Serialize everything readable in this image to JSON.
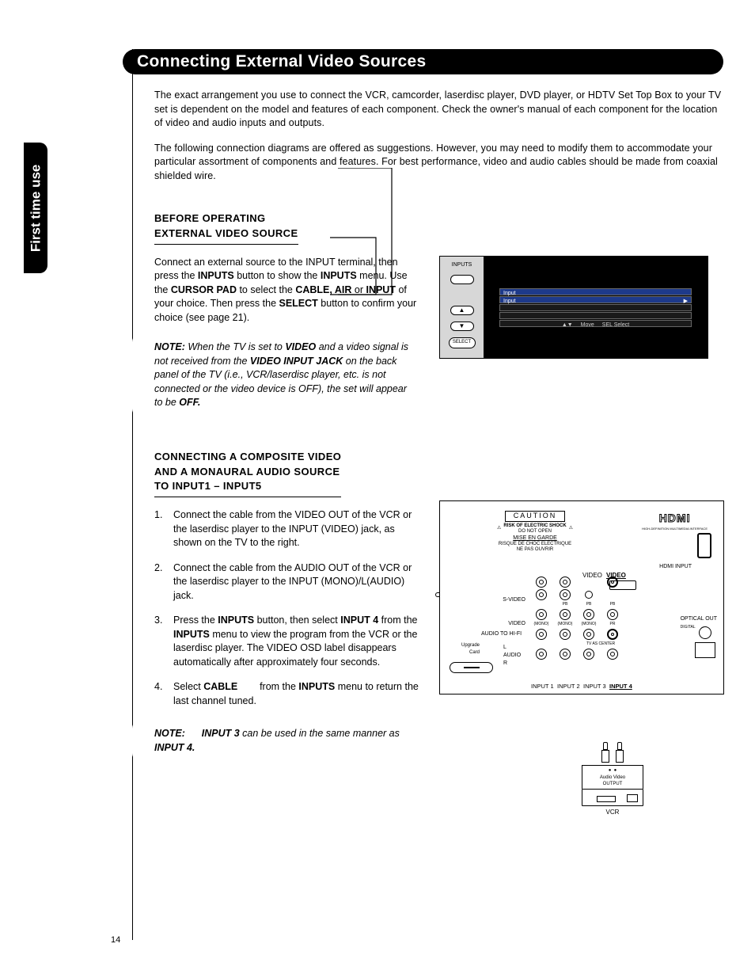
{
  "sideTab": "First time use",
  "title": "Connecting External Video Sources",
  "intro": {
    "p1": "The exact arrangement you use to connect the VCR, camcorder, laserdisc player, DVD player, or HDTV Set Top Box to your TV set is dependent on the model and features of each component. Check the owner's manual of each component for the location of video and audio inputs and outputs.",
    "p2": "The following connection diagrams are offered as suggestions. However, you may need to modify them to accommodate your particular assortment of components and features. For best performance, video and audio cables should be made from coaxial shielded wire."
  },
  "section1": {
    "heading_l1": "BEFORE OPERATING",
    "heading_l2": "EXTERNAL VIDEO SOURCE",
    "p1a": "Connect an external source to the INPUT terminal, then press the ",
    "p1b": "INPUTS",
    "p1c": " button to show the ",
    "p1d": "INPUTS",
    "p1e": " menu. Use the ",
    "p1f": "CURSOR PAD",
    "p1g": " to select the ",
    "p1h": "CABLE, AIR",
    "p1i": " or ",
    "p1j": "INPUT",
    "p1k": " of your choice. Then press the ",
    "p1l": "SELECT",
    "p1m": " button to confirm your choice (see page 21).",
    "note_label": "NOTE:",
    "note_a": "When the TV is set to ",
    "note_b": "VIDEO",
    "note_c": " and a video signal is not received from the ",
    "note_d": "VIDEO INPUT JACK",
    "note_e": " on the back panel of the TV (i.e., VCR/laserdisc player, etc. is not connected or the video device is OFF), the set will appear to be ",
    "note_f": "OFF."
  },
  "osd": {
    "inputs": "INPUTS",
    "select": "SELECT",
    "row1": "Input",
    "row2": "Input",
    "arrow": "▶",
    "hint_move": "Move",
    "hint_sel": "SEL Select",
    "hint_icon": "▲▼"
  },
  "section2": {
    "heading_l1": "CONNECTING A COMPOSITE VIDEO",
    "heading_l2": "AND A MONAURAL AUDIO SOURCE",
    "heading_l3": "TO INPUT1 – INPUT5",
    "steps": {
      "s1": "Connect the cable from the VIDEO OUT of the VCR or the laserdisc player to the INPUT (VIDEO) jack, as shown on the TV to the right.",
      "s2": "Connect the cable from the AUDIO OUT of the VCR or the laserdisc player to the INPUT (MONO)/L(AUDIO) jack.",
      "s3a": "Press the ",
      "s3b": "INPUTS",
      "s3c": " button, then select ",
      "s3d": "INPUT 4",
      "s3e": " from the ",
      "s3f": "INPUTS",
      "s3g": " menu to view the program from the VCR or the laserdisc player. The VIDEO OSD label disappears automatically after approximately four seconds.",
      "s4a": "Select ",
      "s4b": "CABLE",
      "s4c": " from the ",
      "s4d": "INPUTS",
      "s4e": " menu to return the last channel tuned."
    },
    "note_label": "NOTE:",
    "note_a": "INPUT 3",
    "note_b": " can be used in the same manner as ",
    "note_c": "INPUT 4."
  },
  "panel": {
    "caution": "CAUTION",
    "caution_t1": "RISK OF ELECTRIC SHOCK",
    "caution_t2": "DO NOT OPEN",
    "mise": "MISE EN GARDE",
    "mise_t1": "RISQUE DE CHOC ELECTRIQUE",
    "mise_t2": "NE PAS OUVRIR",
    "hdmi": "HDMI",
    "hdmi_sub": "HIGH-DEFINITION MULTIMEDIA INTERFACE",
    "hdmi_input": "HDMI INPUT",
    "video_u": "VIDEO",
    "video4": "VIDEO",
    "svideo": "S-VIDEO",
    "video": "VIDEO",
    "audio_hifi": "AUDIO TO HI-FI",
    "mono": "(MONO)",
    "mono2": "(MONO)",
    "mono3": "(MONO)",
    "upgrade": "Upgrade Card",
    "audio_l": "AUDIO",
    "l": "L",
    "r": "R",
    "pb": "PB",
    "pr": "PR",
    "tv_center": "TV AS CENTER",
    "optical": "OPTICAL OUT",
    "digital": "DIGITAL",
    "in1": "INPUT 1",
    "in2": "INPUT 2",
    "in3": "INPUT 3",
    "in4": "INPUT 4"
  },
  "vcr": {
    "jack_a": "●",
    "jack_v": "●",
    "out_a": "Audio",
    "out_v": "Video",
    "out": "OUTPUT",
    "label": "VCR"
  },
  "pageNumber": "14"
}
